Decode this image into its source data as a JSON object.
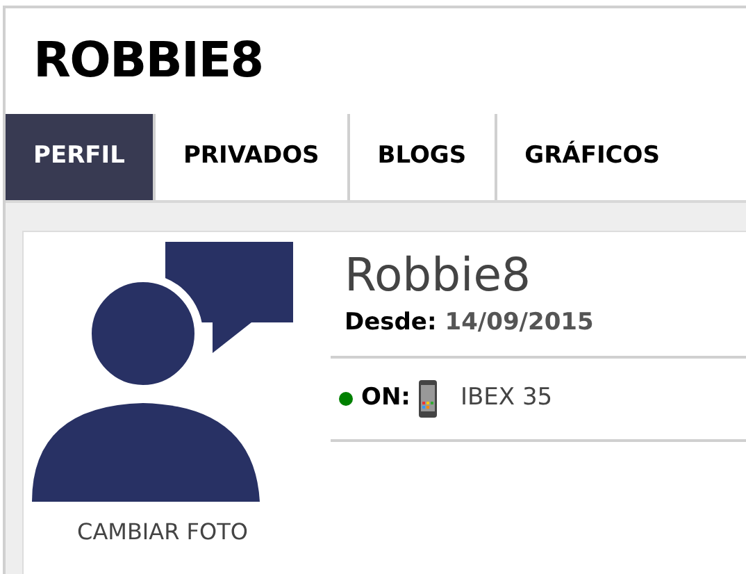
{
  "title": "ROBBIE8",
  "tabs": [
    {
      "label": "PERFIL",
      "selected": true
    },
    {
      "label": "PRIVADOS",
      "selected": false
    },
    {
      "label": "BLOGS",
      "selected": false
    },
    {
      "label": "GRÁFICOS",
      "selected": false
    }
  ],
  "profile": {
    "change_photo": "CAMBIAR FOTO",
    "name": "Robbie8",
    "since_label": "Desde:",
    "since_value": "14/09/2015",
    "online": true,
    "status_label": "ON:",
    "market": "IBEX 35"
  }
}
